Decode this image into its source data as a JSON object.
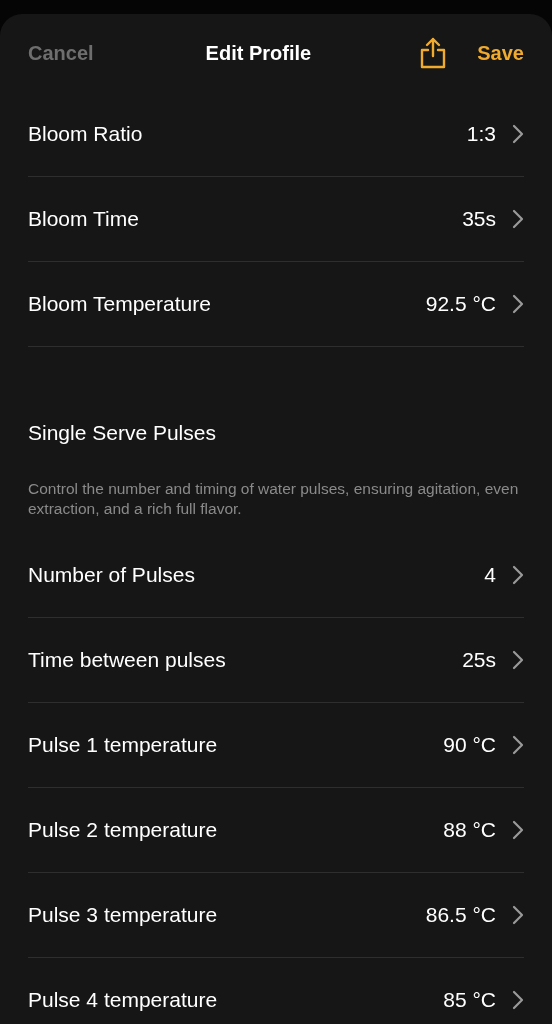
{
  "header": {
    "cancel": "Cancel",
    "title": "Edit Profile",
    "save": "Save"
  },
  "bloom_rows": [
    {
      "label": "Bloom Ratio",
      "value": "1:3"
    },
    {
      "label": "Bloom Time",
      "value": "35s"
    },
    {
      "label": "Bloom Temperature",
      "value": "92.5 °C"
    }
  ],
  "section": {
    "title": "Single Serve Pulses",
    "description": "Control the number and timing of water pulses, ensuring agitation, even extraction, and a rich full flavor."
  },
  "pulse_rows": [
    {
      "label": "Number of Pulses",
      "value": "4"
    },
    {
      "label": "Time between pulses",
      "value": "25s"
    },
    {
      "label": "Pulse 1 temperature",
      "value": "90 °C"
    },
    {
      "label": "Pulse 2 temperature",
      "value": "88 °C"
    },
    {
      "label": "Pulse 3 temperature",
      "value": "86.5 °C"
    },
    {
      "label": "Pulse 4 temperature",
      "value": "85 °C"
    }
  ]
}
